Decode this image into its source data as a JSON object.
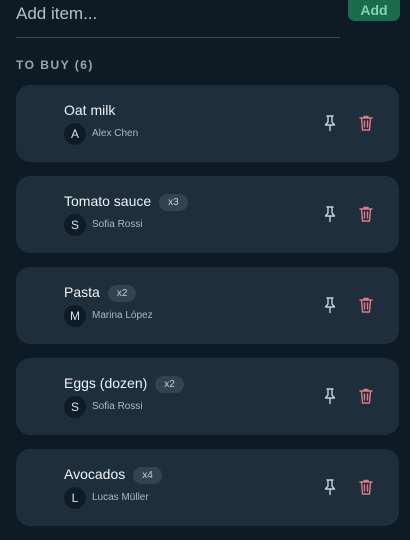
{
  "add_bar": {
    "placeholder": "Add item...",
    "button_label": "Add"
  },
  "section": {
    "title": "TO BUY (6)"
  },
  "items": [
    {
      "name": "Oat milk",
      "qty": "",
      "avatar": "A",
      "person": "Alex Chen"
    },
    {
      "name": "Tomato sauce",
      "qty": "x3",
      "avatar": "S",
      "person": "Sofia Rossi"
    },
    {
      "name": "Pasta",
      "qty": "x2",
      "avatar": "M",
      "person": "Marina López"
    },
    {
      "name": "Eggs (dozen)",
      "qty": "x2",
      "avatar": "S",
      "person": "Sofia Rossi"
    },
    {
      "name": "Avocados",
      "qty": "x4",
      "avatar": "L",
      "person": "Lucas Müller"
    }
  ],
  "icons": {
    "pin": "pin-icon",
    "delete": "trash-icon"
  },
  "colors": {
    "background": "#0e1a24",
    "card": "#1e2e3b",
    "accent_button": "#1b6b4f",
    "delete_icon": "#e07a86"
  }
}
